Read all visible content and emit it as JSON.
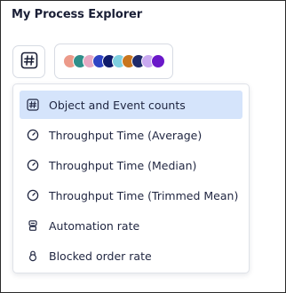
{
  "panel": {
    "title": "My Process Explorer"
  },
  "toolbar": {
    "kpi_button_icon": "hash-icon",
    "color_button_swatches": [
      "#ec9a8a",
      "#2f8f8a",
      "#e7a9c3",
      "#2f44c4",
      "#0e1a6b",
      "#7fd0e0",
      "#c9761e",
      "#1e2a6a",
      "#c9a9f0",
      "#6a18c9"
    ]
  },
  "menu": {
    "items": [
      {
        "label": "Object and Event counts",
        "icon": "hash-icon",
        "selected": true
      },
      {
        "label": "Throughput Time (Average)",
        "icon": "clock-icon",
        "selected": false
      },
      {
        "label": "Throughput Time (Median)",
        "icon": "clock-icon",
        "selected": false
      },
      {
        "label": "Throughput Time (Trimmed Mean)",
        "icon": "clock-icon",
        "selected": false
      },
      {
        "label": "Automation rate",
        "icon": "robot-icon",
        "selected": false
      },
      {
        "label": "Blocked order rate",
        "icon": "lock-icon",
        "selected": false
      }
    ]
  }
}
